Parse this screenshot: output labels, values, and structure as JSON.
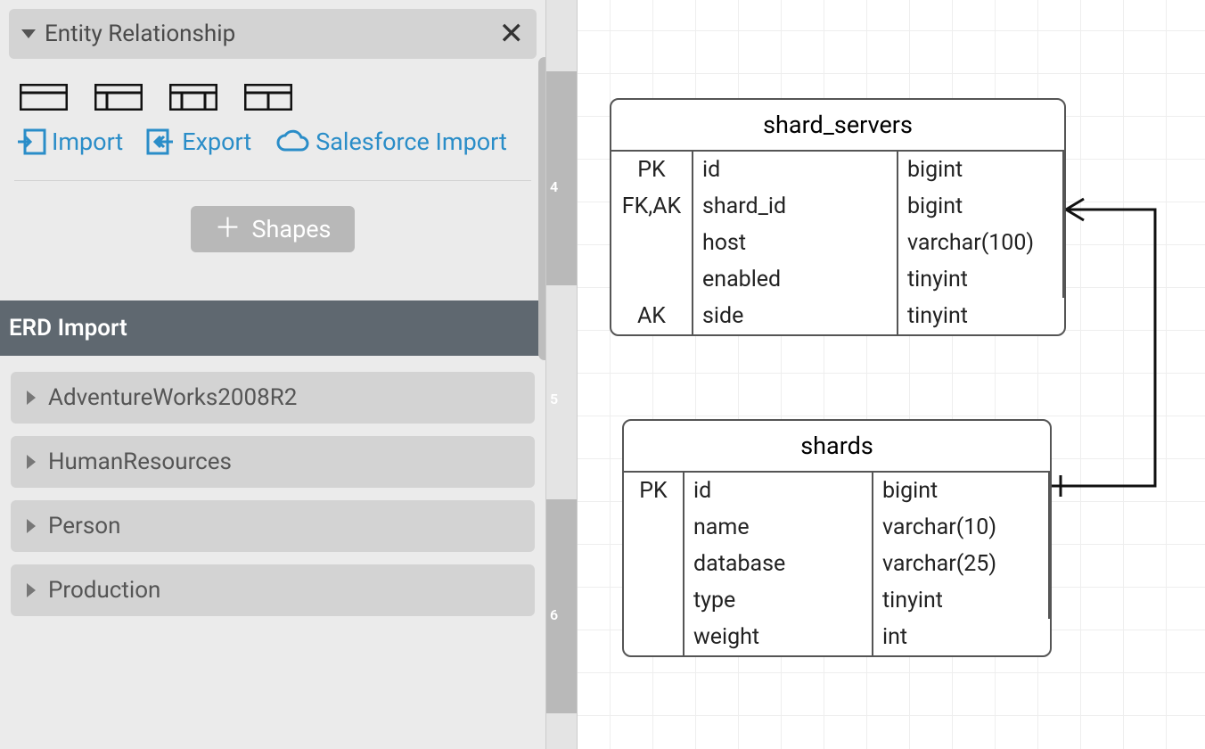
{
  "sidebar": {
    "panel_title": "Entity Relationship",
    "actions": {
      "import": "Import",
      "export": "Export",
      "salesforce": "Salesforce Import"
    },
    "shapes_button": "Shapes",
    "erd_title": "ERD Import",
    "tree": [
      "AdventureWorks2008R2",
      "HumanResources",
      "Person",
      "Production"
    ]
  },
  "ruler": {
    "ticks": [
      "4",
      "5",
      "6"
    ]
  },
  "entities": [
    {
      "name": "shard_servers",
      "rows": [
        {
          "key": "PK",
          "col": "id",
          "type": "bigint"
        },
        {
          "key": "FK,AK",
          "col": "shard_id",
          "type": "bigint"
        },
        {
          "key": "",
          "col": "host",
          "type": "varchar(100)"
        },
        {
          "key": "",
          "col": "enabled",
          "type": "tinyint"
        },
        {
          "key": "AK",
          "col": "side",
          "type": "tinyint"
        }
      ]
    },
    {
      "name": "shards",
      "rows": [
        {
          "key": "PK",
          "col": "id",
          "type": "bigint"
        },
        {
          "key": "",
          "col": "name",
          "type": "varchar(10)"
        },
        {
          "key": "",
          "col": "database",
          "type": "varchar(25)"
        },
        {
          "key": "",
          "col": "type",
          "type": "tinyint"
        },
        {
          "key": "",
          "col": "weight",
          "type": "int"
        }
      ]
    }
  ]
}
